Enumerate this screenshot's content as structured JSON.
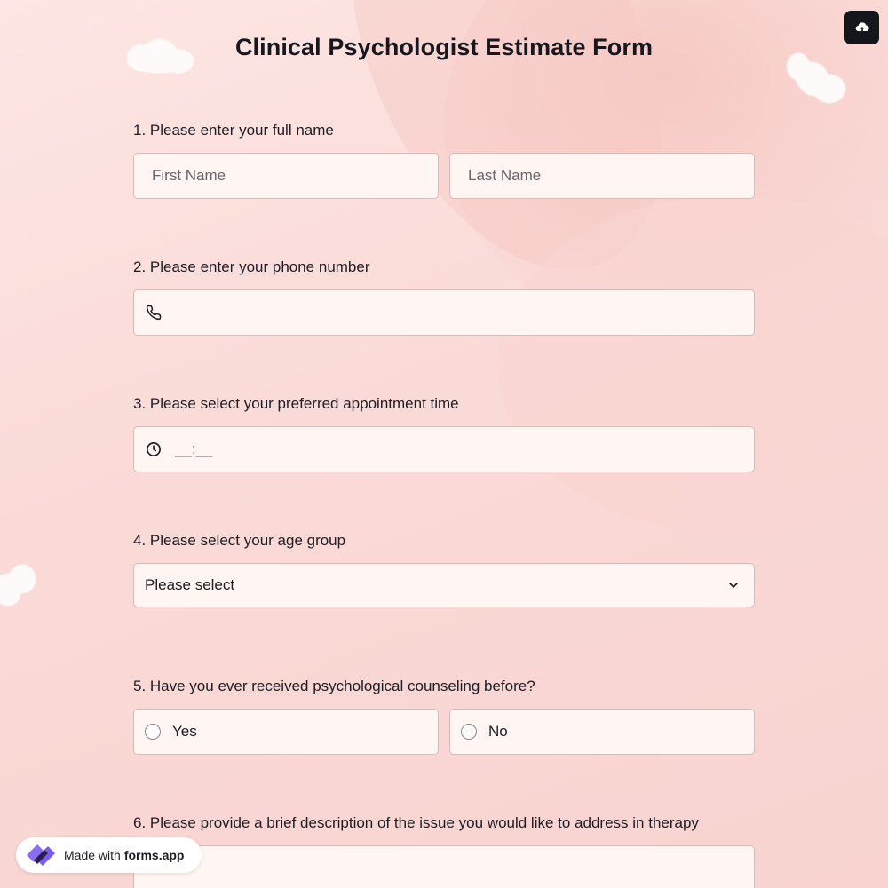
{
  "form": {
    "title": "Clinical Psychologist Estimate Form"
  },
  "questions": {
    "q1": {
      "label": "1.  Please enter your full name",
      "first_placeholder": "First Name",
      "last_placeholder": "Last Name"
    },
    "q2": {
      "label": "2. Please enter your phone number",
      "icon": "phone-icon"
    },
    "q3": {
      "label": "3. Please select your preferred appointment time",
      "placeholder": "__:__",
      "icon": "clock-icon"
    },
    "q4": {
      "label": "4. Please select your age group",
      "selected": "Please select",
      "icon": "chevron-down-icon"
    },
    "q5": {
      "label": "5. Have you ever received psychological counseling before?",
      "options": [
        "Yes",
        "No"
      ]
    },
    "q6": {
      "label": "6. Please provide a brief description of the issue you would like to address in therapy"
    }
  },
  "badge": {
    "prefix": "Made with",
    "brand": "forms.app"
  },
  "icons": {
    "upload": "cloud-upload-icon",
    "logo": "forms-app-logo-icon"
  },
  "colors": {
    "background": "#fbdcda",
    "field_bg": "#fff5f3",
    "field_border": "#d9bcb9",
    "button_dark": "#15161c",
    "logo_purple": "#7b5cf0"
  }
}
